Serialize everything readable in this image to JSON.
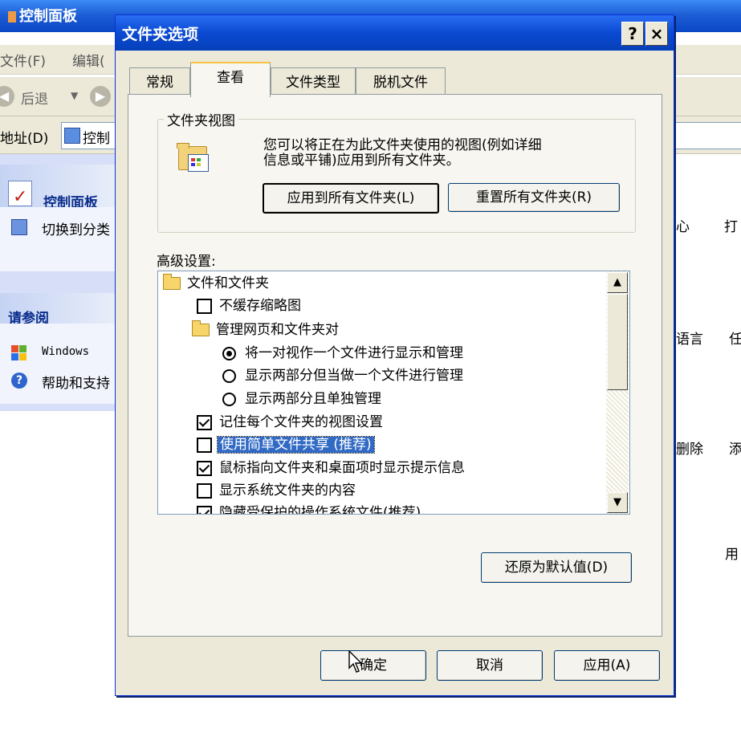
{
  "background_window": {
    "title": "控制面板",
    "menu": [
      "文件(F)",
      "编辑("
    ],
    "back_label": "后退",
    "address_label": "地址(D)",
    "address_value": "控制",
    "sidebar": {
      "panel_title": "控制面板",
      "switch_label": "切换到分类",
      "see_also_title": "请参阅",
      "links": [
        "Windows ",
        "帮助和支持"
      ]
    },
    "content_fragments": [
      "心",
      "打",
      "语言",
      "任",
      "删除",
      "添",
      "用"
    ]
  },
  "dialog": {
    "title": "文件夹选项",
    "help_button": "?",
    "close_button": "×",
    "tabs": [
      "常规",
      "查看",
      "文件类型",
      "脱机文件"
    ],
    "active_tab": "查看",
    "folder_views": {
      "group_label": "文件夹视图",
      "description_line1": "您可以将正在为此文件夹使用的视图(例如详细",
      "description_line2": "信息或平铺)应用到所有文件夹。",
      "apply_all_button": "应用到所有文件夹(L)",
      "reset_all_button": "重置所有文件夹(R)"
    },
    "advanced": {
      "label": "高级设置:",
      "items": [
        {
          "type": "folder",
          "text": "文件和文件夹"
        },
        {
          "type": "checkbox",
          "checked": false,
          "text": "不缓存缩略图"
        },
        {
          "type": "folder",
          "text": "管理网页和文件夹对"
        },
        {
          "type": "radio",
          "checked": true,
          "text": "将一对视作一个文件进行显示和管理"
        },
        {
          "type": "radio",
          "checked": false,
          "text": "显示两部分但当做一个文件进行管理"
        },
        {
          "type": "radio",
          "checked": false,
          "text": "显示两部分且单独管理"
        },
        {
          "type": "checkbox",
          "checked": true,
          "text": "记住每个文件夹的视图设置"
        },
        {
          "type": "checkbox",
          "checked": false,
          "text": "使用简单文件共享 (推荐)",
          "selected": true
        },
        {
          "type": "checkbox",
          "checked": true,
          "text": "鼠标指向文件夹和桌面项时显示提示信息"
        },
        {
          "type": "checkbox",
          "checked": false,
          "text": "显示系统文件夹的内容"
        },
        {
          "type": "checkbox",
          "checked": true,
          "text": "隐藏受保护的操作系统文件(推荐)"
        }
      ],
      "restore_defaults_button": "还原为默认值(D)"
    },
    "footer": {
      "ok_button": "确定",
      "cancel_button": "取消",
      "apply_button": "应用(A)"
    }
  },
  "colors": {
    "titlebar_blue": "#0a4ad2",
    "dialog_face": "#ece9d8",
    "selection": "#316ac5"
  }
}
